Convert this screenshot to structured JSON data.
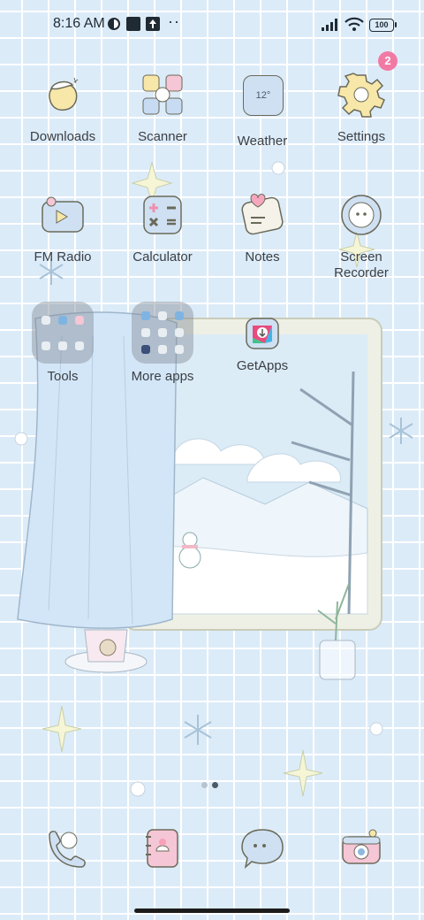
{
  "status_bar": {
    "time": "8:16 AM",
    "battery": "100"
  },
  "apps": [
    {
      "label": "Downloads"
    },
    {
      "label": "Scanner"
    },
    {
      "label": "Weather",
      "icon_text": "12°"
    },
    {
      "label": "Settings",
      "badge": "2"
    },
    {
      "label": "FM Radio"
    },
    {
      "label": "Calculator"
    },
    {
      "label": "Notes"
    },
    {
      "label": "Screen Recorder"
    },
    {
      "label": "Tools"
    },
    {
      "label": "More apps"
    },
    {
      "label": "GetApps"
    }
  ],
  "pagination": {
    "page": 2,
    "total": 2
  }
}
